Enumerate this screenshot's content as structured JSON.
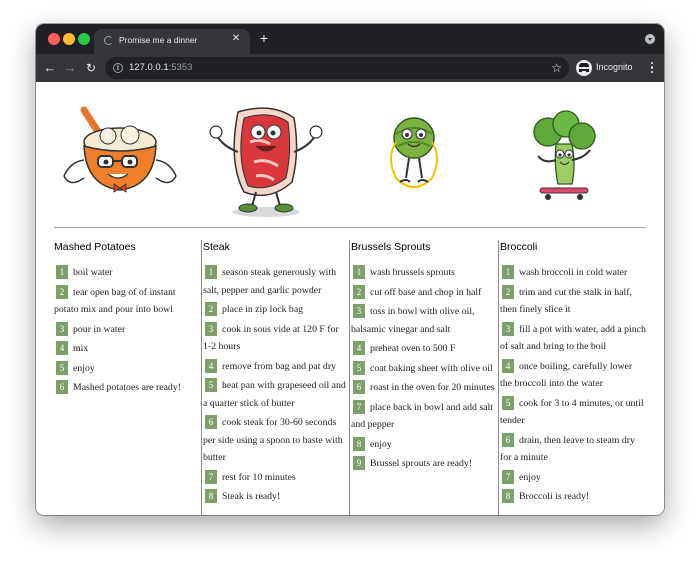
{
  "browser": {
    "tab_title": "Promise me a dinner",
    "url_host": "127.0.0.1",
    "url_port": ":5353",
    "incognito_label": "Incognito"
  },
  "recipes": [
    {
      "title": "Mashed Potatoes",
      "steps": [
        {
          "n": "1",
          "text": "boil water"
        },
        {
          "n": "2",
          "text": "tear open bag of of instant potato mix and pour into bowl"
        },
        {
          "n": "3",
          "text": "pour in water"
        },
        {
          "n": "4",
          "text": "mix"
        },
        {
          "n": "5",
          "text": "enjoy"
        },
        {
          "n": "6",
          "text": "Mashed potatoes are ready!"
        }
      ]
    },
    {
      "title": "Steak",
      "steps": [
        {
          "n": "1",
          "text": "season steak generously with salt, pepper and garlic powder"
        },
        {
          "n": "2",
          "text": "place in zip lock bag"
        },
        {
          "n": "3",
          "text": "cook in sous vide at 120 F for 1-2 hours"
        },
        {
          "n": "4",
          "text": "remove from bag and pat dry"
        },
        {
          "n": "5",
          "text": "heat pan with grapeseed oil and a quarter stick of butter"
        },
        {
          "n": "6",
          "text": "cook steak for 30-60 seconds per side using a spoon to baste with butter"
        },
        {
          "n": "7",
          "text": "rest for 10 minutes"
        },
        {
          "n": "8",
          "text": "Steak is ready!"
        }
      ]
    },
    {
      "title": "Brussels Sprouts",
      "steps": [
        {
          "n": "1",
          "text": "wash brussels sprouts"
        },
        {
          "n": "2",
          "text": "cut off base and chop in half"
        },
        {
          "n": "3",
          "text": "toss in bowl with olive oil, balsamic vinegar and salt"
        },
        {
          "n": "4",
          "text": "preheat oven to 500 F"
        },
        {
          "n": "5",
          "text": "coat baking sheet with olive oil"
        },
        {
          "n": "6",
          "text": "roast in the oven for 20 minutes"
        },
        {
          "n": "7",
          "text": "place back in bowl and add salt and pepper"
        },
        {
          "n": "8",
          "text": "enjoy"
        },
        {
          "n": "9",
          "text": "Brussel sprouts are ready!"
        }
      ]
    },
    {
      "title": "Broccoli",
      "steps": [
        {
          "n": "1",
          "text": "wash broccoli in cold water"
        },
        {
          "n": "2",
          "text": "trim and cut the stalk in half, then finely slice it"
        },
        {
          "n": "3",
          "text": "fill a pot with water, add a pinch of salt and bring to the boil"
        },
        {
          "n": "4",
          "text": "once boiling, carefully lower the broccoli into the water"
        },
        {
          "n": "5",
          "text": "cook for 3 to 4 minutes, or until tender"
        },
        {
          "n": "6",
          "text": "drain, then leave to steam dry for a minute"
        },
        {
          "n": "7",
          "text": "enjoy"
        },
        {
          "n": "8",
          "text": "Broccoli is ready!"
        }
      ]
    }
  ],
  "icons": {
    "mascots": [
      "mashed-potatoes-mascot-icon",
      "steak-mascot-icon",
      "brussels-sprout-mascot-icon",
      "broccoli-mascot-icon"
    ]
  },
  "colors": {
    "step_number_bg": "#7d9f6a",
    "divider": "#a6a6a6"
  }
}
